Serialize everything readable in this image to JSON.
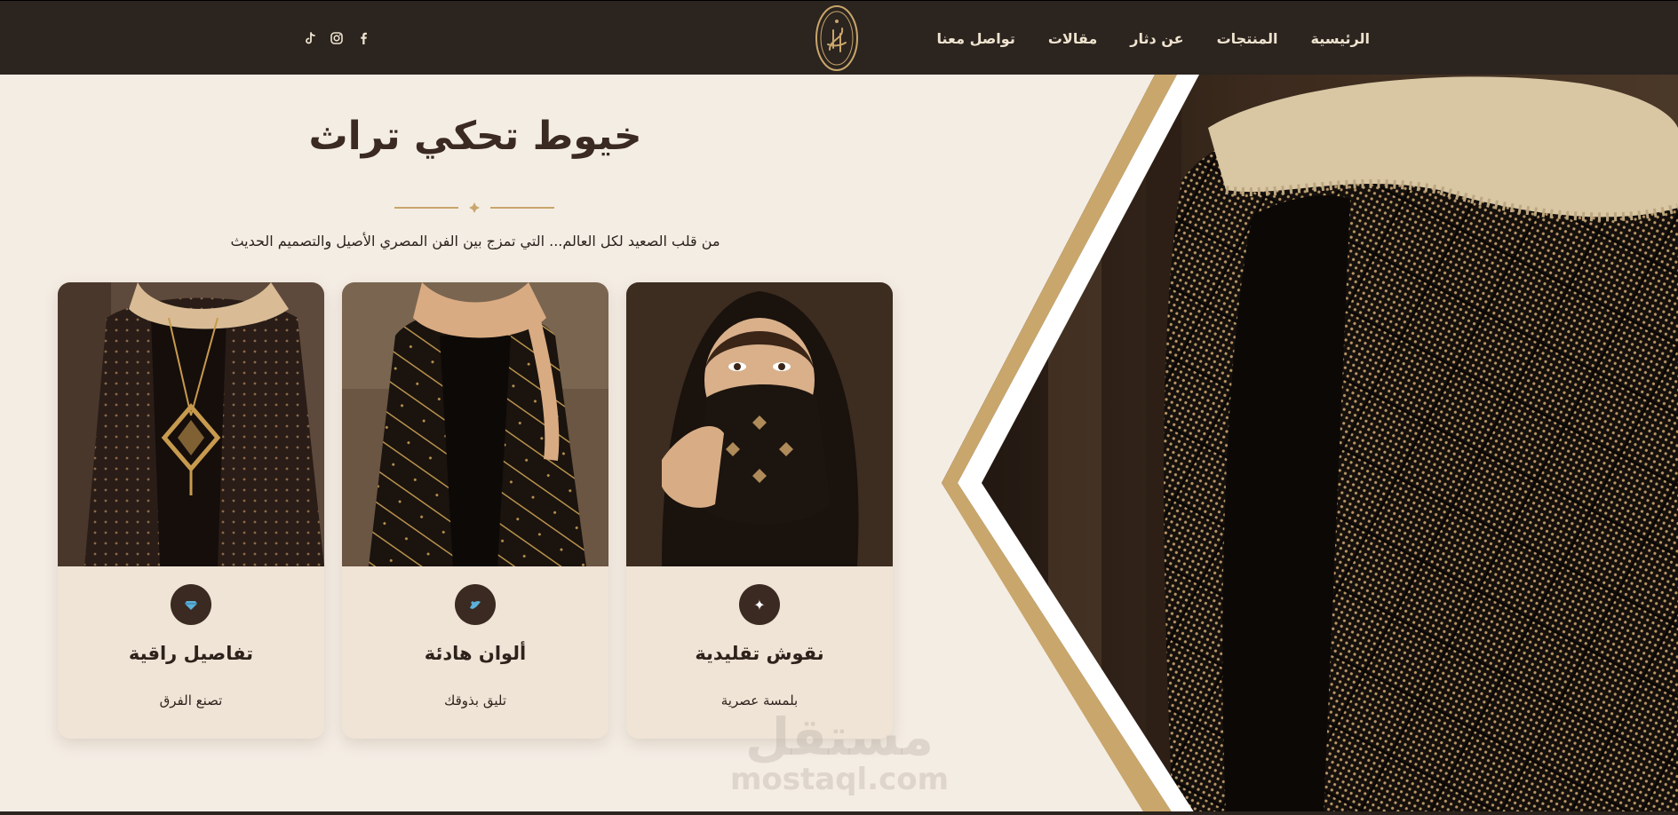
{
  "nav": {
    "items": [
      "الرئيسية",
      "المنتجات",
      "عن دثار",
      "مقالات",
      "تواصل معنا"
    ]
  },
  "social": {
    "icons": [
      "facebook-icon",
      "instagram-icon",
      "tiktok-icon"
    ]
  },
  "hero": {
    "title": "خيوط تحكي تراث",
    "subtitle": "من قلب الصعيد لكل العالم... التي تمزج بين الفن المصري الأصيل والتصميم الحديث"
  },
  "cards": [
    {
      "title": "نقوش تقليدية",
      "description": "بلمسة عصرية",
      "icon": "sparkle-icon"
    },
    {
      "title": "ألوان هادئة",
      "description": "تليق بذوقك",
      "icon": "palette-icon"
    },
    {
      "title": "تفاصيل راقية",
      "description": "تصنع الفرق",
      "icon": "diamond-icon"
    }
  ],
  "watermark": {
    "arabic": "مستقل",
    "latin": "mostaql.com"
  },
  "colors": {
    "header_bg": "#2b241f",
    "page_bg": "#f4ede4",
    "gold_accent": "#c9a66b",
    "card_bg": "#efe4d6",
    "dark_text": "#3a2a22"
  }
}
